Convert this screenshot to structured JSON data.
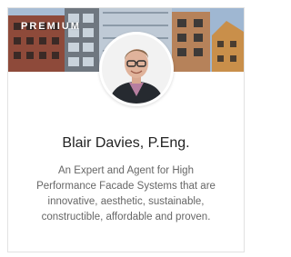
{
  "card": {
    "badge": "PREMIUM",
    "name": "Blair Davies, P.Eng.",
    "bio_lines": [
      "An Expert and Agent for High",
      "Performance Facade Systems that are",
      "innovative, aesthetic, sustainable,",
      "constructible, affordable and proven."
    ]
  },
  "colors": {
    "badge_text": "#ffffff",
    "name_text": "#222222",
    "bio_text": "#666666",
    "border": "#e2e2e2"
  },
  "icons": {
    "banner": "building-facades-image",
    "avatar": "profile-photo"
  }
}
